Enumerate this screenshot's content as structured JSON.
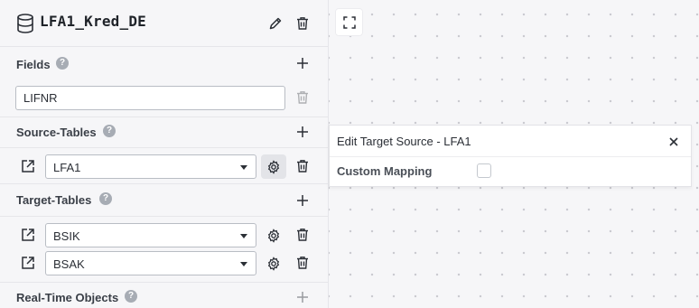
{
  "project": {
    "name": "LFA1_Kred_DE"
  },
  "sections": {
    "fields": {
      "label": "Fields",
      "help": "?",
      "items": [
        {
          "value": "LIFNR"
        }
      ]
    },
    "source_tables": {
      "label": "Source-Tables",
      "help": "?",
      "items": [
        {
          "value": "LFA1"
        }
      ]
    },
    "target_tables": {
      "label": "Target-Tables",
      "help": "?",
      "items": [
        {
          "value": "BSIK"
        },
        {
          "value": "BSAK"
        }
      ]
    },
    "realtime_objects": {
      "label": "Real-Time Objects",
      "help": "?"
    }
  },
  "panel": {
    "title": "Edit Target Source - LFA1",
    "custom_mapping_label": "Custom Mapping",
    "custom_mapping_checked": false
  },
  "icons": {
    "project": "database-icon",
    "edit": "pencil-icon",
    "delete": "trash-icon",
    "add": "plus-icon",
    "open": "external-link-icon",
    "settings": "gear-icon",
    "close": "close-icon",
    "fit": "fit-view-icon"
  },
  "colors": {
    "sidebar_bg": "#f6f6f8",
    "text": "#2b2f36",
    "help_badge": "#a7acb4"
  }
}
